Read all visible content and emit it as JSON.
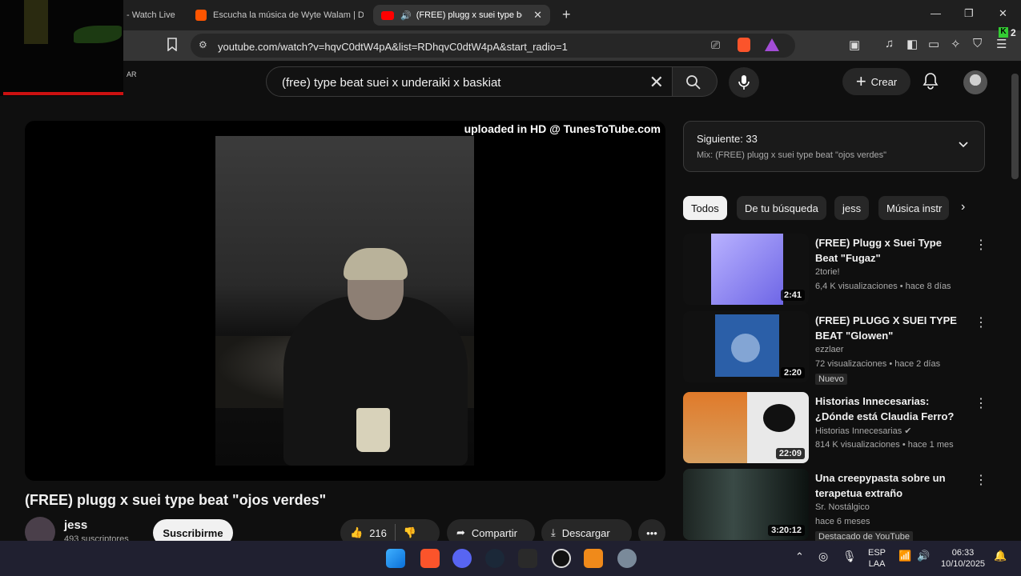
{
  "browser": {
    "tabs": [
      {
        "label": "- Watch Live"
      },
      {
        "label": "Escucha la música de Wyte Walam | D"
      },
      {
        "label": "(FREE) plugg x suei type beat"
      }
    ],
    "url": "youtube.com/watch?v=hqvC0dtW4pA&list=RDhqvC0dtW4pA&start_radio=1",
    "ext_badge": "2"
  },
  "overlay_tag": "AR",
  "masthead": {
    "search_query": "(free) type beat suei x underaiki x baskiat",
    "create_label": "Crear"
  },
  "player": {
    "watermark": "uploaded in HD @ TunesToTube.com"
  },
  "video": {
    "title": "(FREE) plugg x suei type beat \"ojos verdes\"",
    "channel": "jess",
    "subscribers": "493 suscriptores",
    "subscribe_label": "Suscribirme",
    "likes": "216",
    "share_label": "Compartir",
    "download_label": "Descargar"
  },
  "up_next": {
    "title": "Siguiente: 33",
    "subtitle": "Mix: (FREE) plugg x suei type beat \"ojos verdes\""
  },
  "chips": [
    "Todos",
    "De tu búsqueda",
    "jess",
    "Música instr"
  ],
  "recommendations": [
    {
      "title": "(FREE) Plugg x Suei Type Beat \"Fugaz\"",
      "channel": "2torie!",
      "meta": "6,4 K visualizaciones • hace 8 días",
      "duration": "2:41",
      "badge": ""
    },
    {
      "title": "(FREE) PLUGG X SUEI TYPE BEAT \"Glowen\"",
      "channel": "ezzlaer",
      "meta": "72 visualizaciones • hace 2 días",
      "duration": "2:20",
      "badge": "Nuevo"
    },
    {
      "title": "Historias Innecesarias: ¿Dónde está Claudia Ferro?",
      "channel": "Historias Innecesarias",
      "meta": "814 K visualizaciones • hace 1 mes",
      "duration": "22:09",
      "badge": ""
    },
    {
      "title": "Una creepypasta sobre un terapetua extraño",
      "channel": "Sr. Nostálgico",
      "meta": "hace 6 meses",
      "duration": "3:20:12",
      "badge": "Destacado de YouTube"
    }
  ],
  "taskbar": {
    "lang": "ESP",
    "layout": "LAA",
    "time": "06:33",
    "date": "10/10/2025"
  }
}
